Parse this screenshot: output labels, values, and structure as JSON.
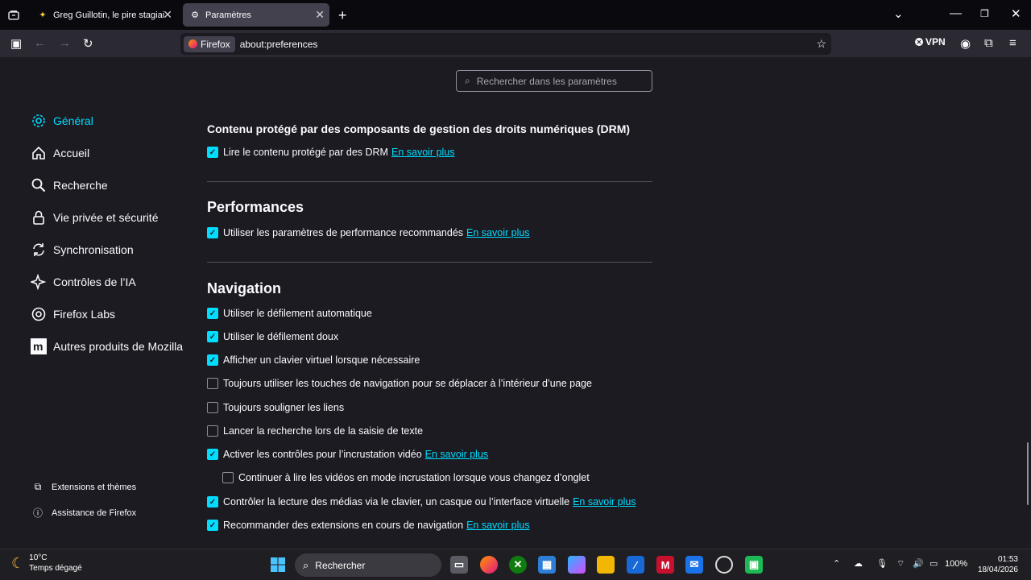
{
  "tabs": [
    {
      "label": "Greg Guillotin, le pire stagiaire",
      "icon": "news-icon"
    },
    {
      "label": "Paramètres",
      "icon": "gear-icon"
    }
  ],
  "urlbar": {
    "identity": "Firefox",
    "url": "about:preferences"
  },
  "toolbar": {
    "vpn_label": "VPN"
  },
  "search": {
    "placeholder": "Rechercher dans les paramètres"
  },
  "sidebar": {
    "items": [
      {
        "label": "Général",
        "icon": "gear-icon",
        "active": true
      },
      {
        "label": "Accueil",
        "icon": "home-icon"
      },
      {
        "label": "Recherche",
        "icon": "search-icon"
      },
      {
        "label": "Vie privée et sécurité",
        "icon": "lock-icon"
      },
      {
        "label": "Synchronisation",
        "icon": "sync-icon"
      },
      {
        "label": "Contrôles de l’IA",
        "icon": "sparkle-icon"
      },
      {
        "label": "Firefox Labs",
        "icon": "labs-icon"
      },
      {
        "label": "Autres produits de Mozilla",
        "icon": "mozilla-icon"
      }
    ],
    "footer": [
      {
        "label": "Extensions et thèmes",
        "icon": "puzzle-icon"
      },
      {
        "label": "Assistance de Firefox",
        "icon": "help-icon"
      }
    ]
  },
  "drm": {
    "heading": "Contenu protégé par des composants de gestion des droits numériques (DRM)",
    "option": {
      "label": "Lire le contenu protégé par des DRM",
      "link": "En savoir plus",
      "checked": true
    }
  },
  "performance": {
    "heading": "Performances",
    "option": {
      "label": "Utiliser les paramètres de performance recommandés",
      "link": "En savoir plus",
      "checked": true
    }
  },
  "navigation": {
    "heading": "Navigation",
    "options": [
      {
        "label": "Utiliser le défilement automatique",
        "checked": true
      },
      {
        "label": "Utiliser le défilement doux",
        "checked": true
      },
      {
        "label": "Afficher un clavier virtuel lorsque nécessaire",
        "checked": true
      },
      {
        "label": "Toujours utiliser les touches de navigation pour se déplacer à l’intérieur d’une page",
        "checked": false
      },
      {
        "label": "Toujours souligner les liens",
        "checked": false
      },
      {
        "label": "Lancer la recherche lors de la saisie de texte",
        "checked": false
      },
      {
        "label": "Activer les contrôles pour l’incrustation vidéo",
        "link": "En savoir plus",
        "checked": true
      },
      {
        "label": "Continuer à lire les vidéos en mode incrustation lorsque vous changez d’onglet",
        "checked": false
      },
      {
        "label": "Contrôler la lecture des médias via le clavier, un casque ou l’interface virtuelle",
        "link": "En savoir plus",
        "checked": true
      },
      {
        "label": "Recommander des extensions en cours de navigation",
        "link": "En savoir plus",
        "checked": true
      }
    ]
  },
  "taskbar": {
    "weather": {
      "temp": "10°C",
      "desc": "Temps dégagé"
    },
    "search_label": "Rechercher",
    "battery": "100%",
    "time": "01:53",
    "date": "18/04/2026"
  }
}
